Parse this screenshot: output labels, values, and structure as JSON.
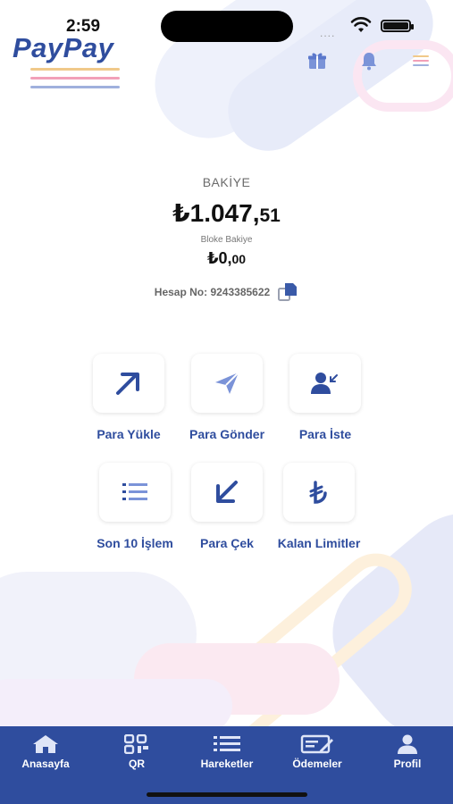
{
  "status": {
    "time": "2:59",
    "signal": "....",
    "icons": [
      "wifi-icon",
      "battery-icon"
    ]
  },
  "brand": {
    "logo_text": "PayPay"
  },
  "header": {
    "icons": [
      "gift-icon",
      "bell-icon",
      "menu-icon"
    ]
  },
  "balance": {
    "label": "BAKİYE",
    "amount_main": "₺1.047,",
    "amount_decimal": "51",
    "blocked_label": "Bloke Bakiye",
    "blocked_main": "₺0,",
    "blocked_decimal": "00",
    "account_text": "Hesap No: 9243385622"
  },
  "actions": [
    {
      "label": "Para Yükle",
      "icon": "arrow-up-right-icon"
    },
    {
      "label": "Para Gönder",
      "icon": "send-icon"
    },
    {
      "label": "Para İste",
      "icon": "user-request-icon"
    },
    {
      "label": "Son 10 İşlem",
      "icon": "list-icon"
    },
    {
      "label": "Para Çek",
      "icon": "arrow-down-left-icon"
    },
    {
      "label": "Kalan Limitler",
      "icon": "lira-icon"
    }
  ],
  "tabs": [
    {
      "label": "Anasayfa",
      "icon": "home-icon"
    },
    {
      "label": "QR",
      "icon": "qr-icon"
    },
    {
      "label": "Hareketler",
      "icon": "list-icon"
    },
    {
      "label": "Ödemeler",
      "icon": "payment-icon"
    },
    {
      "label": "Profil",
      "icon": "user-icon"
    }
  ],
  "colors": {
    "brand": "#2f4d9e",
    "accent_icon": "#7b93d8"
  }
}
